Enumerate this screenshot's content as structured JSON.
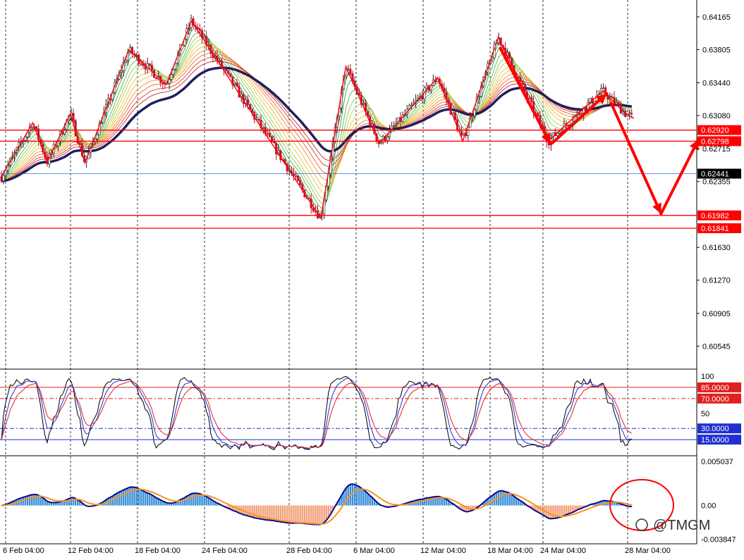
{
  "watermark": {
    "text": "@TMGM"
  },
  "colors": {
    "up": "#222222",
    "down": "#c8102e",
    "level": "#ff0000",
    "current": "#2f6fe0",
    "ma": "#1f1f5e",
    "arrow": "#ff0000",
    "macd_pos": "#3a8fd8",
    "macd_neg": "#f3a07a",
    "macd_line": "#0a0a8a",
    "signal_line": "#f7931e",
    "rsi_black": "#000000",
    "rsi_blue": "#2030d0",
    "rsi_red": "#e02020"
  },
  "chart_data": [
    {
      "type": "candlestick",
      "x_labels": [
        "6 Feb 04:00",
        "12 Feb 04:00",
        "18 Feb 04:00",
        "24 Feb 04:00",
        "28 Feb 04:00",
        "6 Mar 04:00",
        "12 Mar 04:00",
        "18 Mar 04:00",
        "24 Mar 04:00",
        "28 Mar 04:00"
      ],
      "y_ticks": [
        "0.64165",
        "0.63805",
        "0.63440",
        "0.63080",
        "0.62715",
        "0.62355",
        "0.61630",
        "0.61270",
        "0.60905",
        "0.60545"
      ],
      "ylim": [
        0.603,
        0.6435
      ],
      "current_price": "0.62441",
      "levels": [
        "0.62920",
        "0.62798",
        "0.61982",
        "0.61841"
      ],
      "zigzag": [
        [
          0,
          0.6241
        ],
        [
          1.5,
          0.63
        ],
        [
          2.2,
          0.6257
        ],
        [
          3.3,
          0.631
        ],
        [
          4.0,
          0.6256
        ],
        [
          6.1,
          0.638
        ],
        [
          7.9,
          0.6342
        ],
        [
          9.1,
          0.6412
        ],
        [
          15.3,
          0.6195
        ],
        [
          16.5,
          0.6362
        ],
        [
          18.1,
          0.6277
        ],
        [
          20.9,
          0.635
        ],
        [
          22.1,
          0.628
        ],
        [
          23.8,
          0.6394
        ],
        [
          26.2,
          0.628
        ],
        [
          28.8,
          0.6335
        ],
        [
          29.9,
          0.631
        ],
        [
          30.3,
          0.6305
        ]
      ],
      "arrows": [
        {
          "from": [
            23.9,
            0.6382
          ],
          "to": [
            26.3,
            0.6277
          ]
        },
        {
          "from": [
            26.4,
            0.6278
          ],
          "to": [
            29.0,
            0.6332
          ]
        },
        {
          "from": [
            29.2,
            0.6322
          ],
          "to": [
            31.6,
            0.62
          ]
        },
        {
          "from": [
            31.6,
            0.62
          ],
          "to": [
            33.4,
            0.6282
          ]
        }
      ]
    },
    {
      "type": "line",
      "name": "Stochastic",
      "y_ticks": [
        "100",
        "50"
      ],
      "ylim": [
        0,
        100
      ],
      "levels": [
        "85.0000",
        "70.0000",
        "30.0000",
        "15.0000"
      ]
    },
    {
      "type": "bar",
      "name": "MACD",
      "y_ticks": [
        "0.005037",
        "0.00",
        "-0.003847"
      ],
      "ylim": [
        -0.0042,
        0.0055
      ]
    }
  ]
}
